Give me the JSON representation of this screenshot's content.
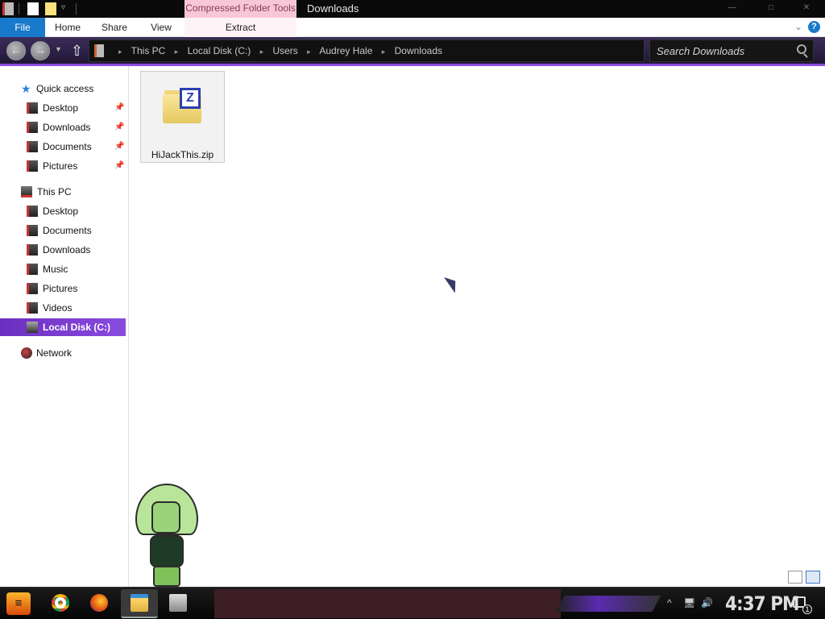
{
  "window": {
    "title": "Downloads",
    "context_tab": "Compressed Folder Tools"
  },
  "ribbon": {
    "tabs": [
      {
        "label": "File"
      },
      {
        "label": "Home"
      },
      {
        "label": "Share"
      },
      {
        "label": "View"
      },
      {
        "label": "Extract"
      }
    ]
  },
  "address": {
    "crumbs": [
      "This PC",
      "Local Disk (C:)",
      "Users",
      "Audrey Hale",
      "Downloads"
    ]
  },
  "search": {
    "placeholder": "Search Downloads"
  },
  "nav": {
    "quick_access": "Quick access",
    "quick_items": [
      {
        "label": "Desktop"
      },
      {
        "label": "Downloads"
      },
      {
        "label": "Documents"
      },
      {
        "label": "Pictures"
      }
    ],
    "this_pc": "This PC",
    "pc_items": [
      {
        "label": "Desktop"
      },
      {
        "label": "Documents"
      },
      {
        "label": "Downloads"
      },
      {
        "label": "Music"
      },
      {
        "label": "Pictures"
      },
      {
        "label": "Videos"
      },
      {
        "label": "Local Disk (C:)"
      }
    ],
    "network": "Network",
    "selected": "Local Disk (C:)"
  },
  "files": [
    {
      "name": "HiJackThis.zip",
      "icon": "zip-folder-icon"
    }
  ],
  "taskbar": {
    "clock": "4:37 PM",
    "notification_count": "1",
    "apps": [
      "chrome-icon",
      "firefox-icon",
      "file-explorer-icon",
      "photos-icon"
    ]
  },
  "colors": {
    "accent": "#8c4be0",
    "file_tab": "#1979ca",
    "context_tab_bg": "#f7c7d6"
  }
}
